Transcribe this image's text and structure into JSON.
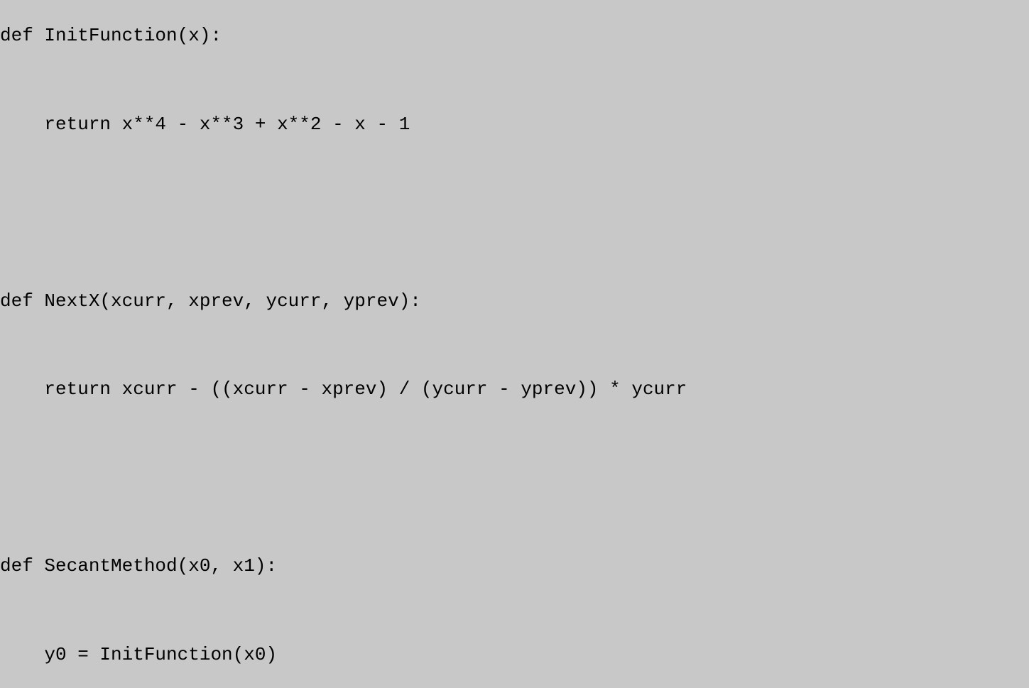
{
  "code": {
    "lines": [
      "def InitFunction(x):",
      "",
      "    return x**4 - x**3 + x**2 - x - 1",
      "",
      "",
      "",
      "def NextX(xcurr, xprev, ycurr, yprev):",
      "",
      "    return xcurr - ((xcurr - xprev) / (ycurr - yprev)) * ycurr",
      "",
      "",
      "",
      "def SecantMethod(x0, x1):",
      "",
      "    y0 = InitFunction(x0)"
    ]
  }
}
